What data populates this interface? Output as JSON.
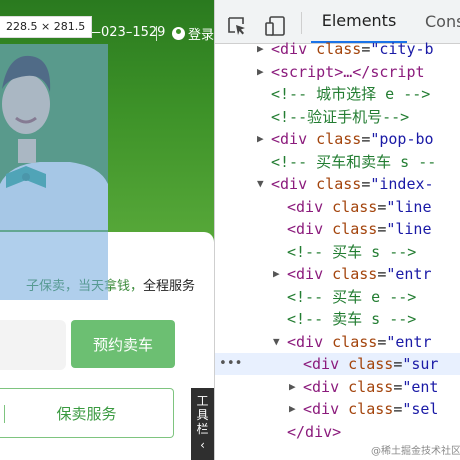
{
  "page": {
    "size_tooltip": "228.5 × 281.5",
    "hotline": "—023–1529",
    "login_label": "登录",
    "service_text": "子保卖，当天拿钱，",
    "service_emphasis": "全程服务",
    "reserve_button": "预约卖车",
    "sell_service_button": "保卖服务",
    "toolbar_tab": [
      "工",
      "具",
      "栏",
      "‹"
    ],
    "colors": {
      "hero_green": "#3d9228",
      "button_green": "#6cbf72",
      "highlight_blue": "#6fa8dc"
    }
  },
  "devtools": {
    "tabs": {
      "elements": "Elements",
      "console": "Cons"
    },
    "icons": {
      "inspect": "inspect-cursor-icon",
      "device": "device-toggle-icon"
    },
    "tree": [
      {
        "indent": 0,
        "arrow": "▶",
        "open": "<div",
        "attr": "class",
        "val": "\"city-b",
        "tail": ""
      },
      {
        "indent": 0,
        "arrow": "▶",
        "open": "<script>",
        "attr": "",
        "val": "",
        "tail": "…</script"
      },
      {
        "indent": 0,
        "arrow": "",
        "comment": "<!-- 城市选择 e -->"
      },
      {
        "indent": 0,
        "arrow": "",
        "comment": "<!--验证手机号-->"
      },
      {
        "indent": 0,
        "arrow": "▶",
        "open": "<div",
        "attr": "class",
        "val": "\"pop-bo",
        "tail": ""
      },
      {
        "indent": 0,
        "arrow": "",
        "comment": "<!-- 买车和卖车 s --"
      },
      {
        "indent": 0,
        "arrow": "▼",
        "open": "<div",
        "attr": "class",
        "val": "\"index-",
        "tail": ""
      },
      {
        "indent": 1,
        "arrow": "",
        "open": "<div",
        "attr": "class",
        "val": "\"line",
        "tail": ""
      },
      {
        "indent": 1,
        "arrow": "",
        "open": "<div",
        "attr": "class",
        "val": "\"line",
        "tail": ""
      },
      {
        "indent": 1,
        "arrow": "",
        "comment": "<!-- 买车 s -->"
      },
      {
        "indent": 1,
        "arrow": "▶",
        "open": "<div",
        "attr": "class",
        "val": "\"entr",
        "tail": ""
      },
      {
        "indent": 1,
        "arrow": "",
        "comment": "<!-- 买车 e -->"
      },
      {
        "indent": 1,
        "arrow": "",
        "comment": "<!-- 卖车 s -->"
      },
      {
        "indent": 1,
        "arrow": "▼",
        "open": "<div",
        "attr": "class",
        "val": "\"entr",
        "tail": ""
      },
      {
        "indent": 2,
        "arrow": "",
        "open": "<div",
        "attr": "class",
        "val": "\"sur",
        "tail": "",
        "selected": true
      },
      {
        "indent": 2,
        "arrow": "▶",
        "open": "<div",
        "attr": "class",
        "val": "\"ent",
        "tail": ""
      },
      {
        "indent": 2,
        "arrow": "▶",
        "open": "<div",
        "attr": "class",
        "val": "\"sel",
        "tail": ""
      },
      {
        "indent": 1,
        "arrow": "",
        "open": "</div>",
        "attr": "",
        "val": "",
        "tail": ""
      }
    ],
    "selected_marker": "•••",
    "watermark": "@稀土掘金技术社区"
  }
}
